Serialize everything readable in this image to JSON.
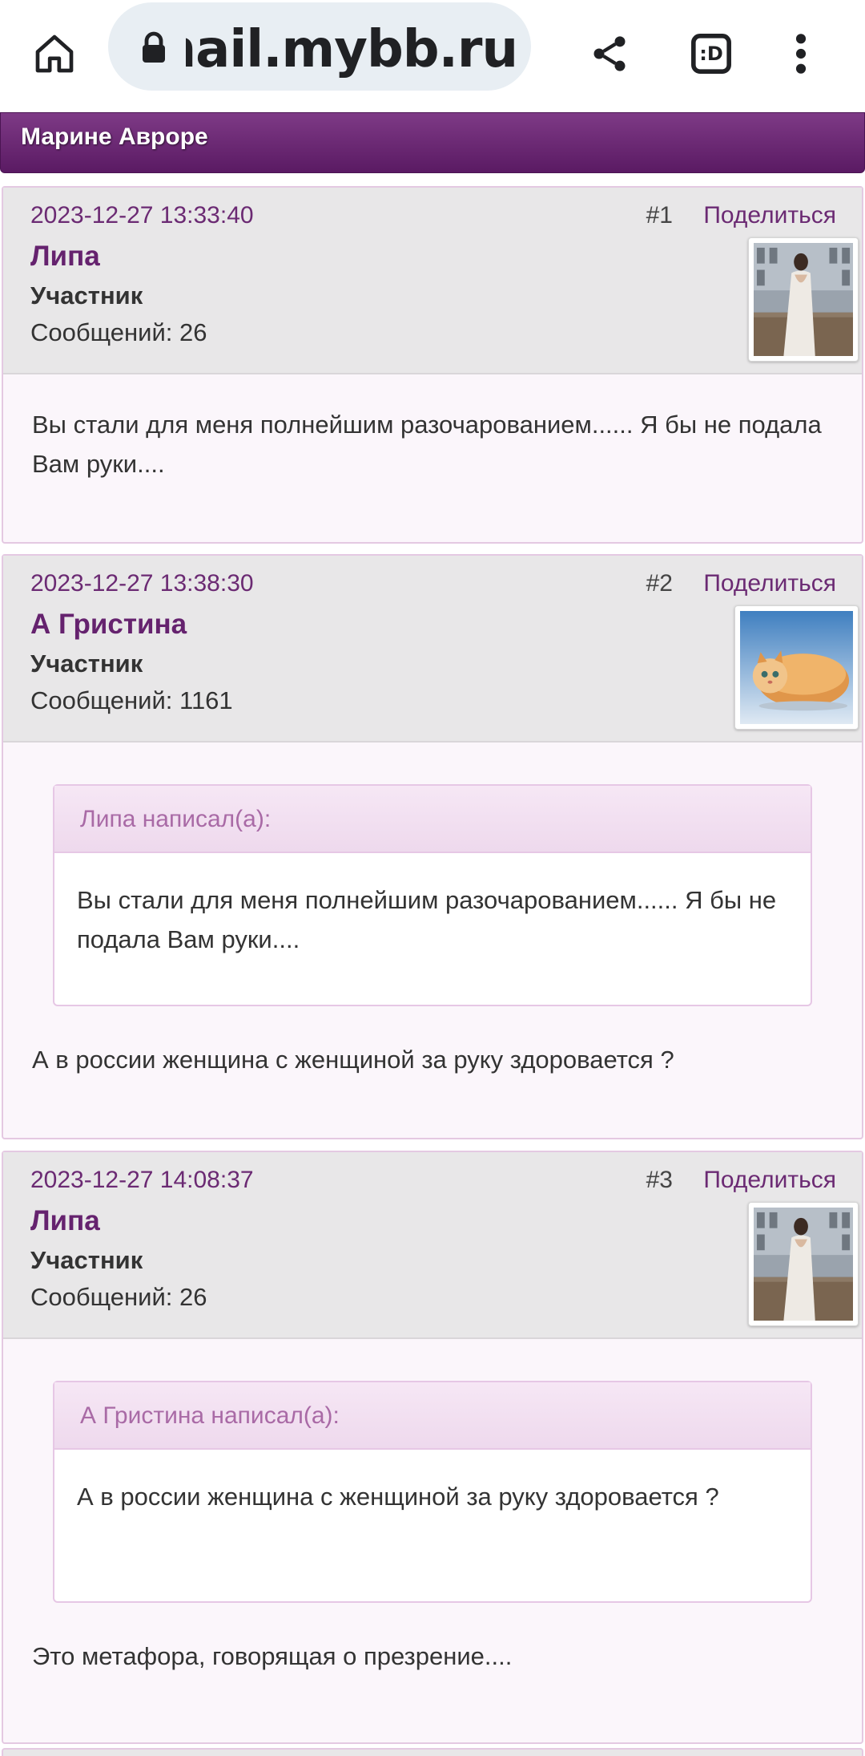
{
  "browser": {
    "url": "nail.mybb.ru",
    "icons": {
      "home": "home-icon",
      "lock": "lock-icon",
      "share": "share-icon",
      "tabs": "tab-switcher-icon",
      "menu": "more-vert-icon"
    },
    "tab_label": ":D"
  },
  "topic": {
    "title": "Марине Авроре"
  },
  "posts": [
    {
      "date": "2023-12-27 13:33:40",
      "number": "#1",
      "share_label": "Поделиться",
      "author": "Липа",
      "role": "Участник",
      "count": "Сообщений: 26",
      "avatar": "bride-photo",
      "text": "Вы стали для меня полнейшим разочарованием...... Я бы не подала Вам руки...."
    },
    {
      "date": "2023-12-27 13:38:30",
      "number": "#2",
      "share_label": "Поделиться",
      "author": "А Гристина",
      "role": "Участник",
      "count": "Сообщений: 1161",
      "avatar": "cat-bread-photo",
      "quote_header": "Липа написал(а):",
      "quote_text": "Вы стали для меня полнейшим разочарованием...... Я бы не подала Вам руки....",
      "text": "А в россии женщина с женщиной за руку здоровается ?"
    },
    {
      "date": "2023-12-27 14:08:37",
      "number": "#3",
      "share_label": "Поделиться",
      "author": "Липа",
      "role": "Участник",
      "count": "Сообщений: 26",
      "avatar": "bride-photo",
      "quote_header": "А Гристина написал(а):",
      "quote_text": "А в россии женщина с женщиной за руку здоровается ?",
      "text": "Это метафора, говорящая о презрение...."
    }
  ],
  "colors": {
    "accent": "#65226e",
    "header_gradient_top": "#7e3a86",
    "header_gradient_bottom": "#5a1a63",
    "post_head_bg": "#e8e7e8",
    "quote_header": "#a96aa6"
  }
}
